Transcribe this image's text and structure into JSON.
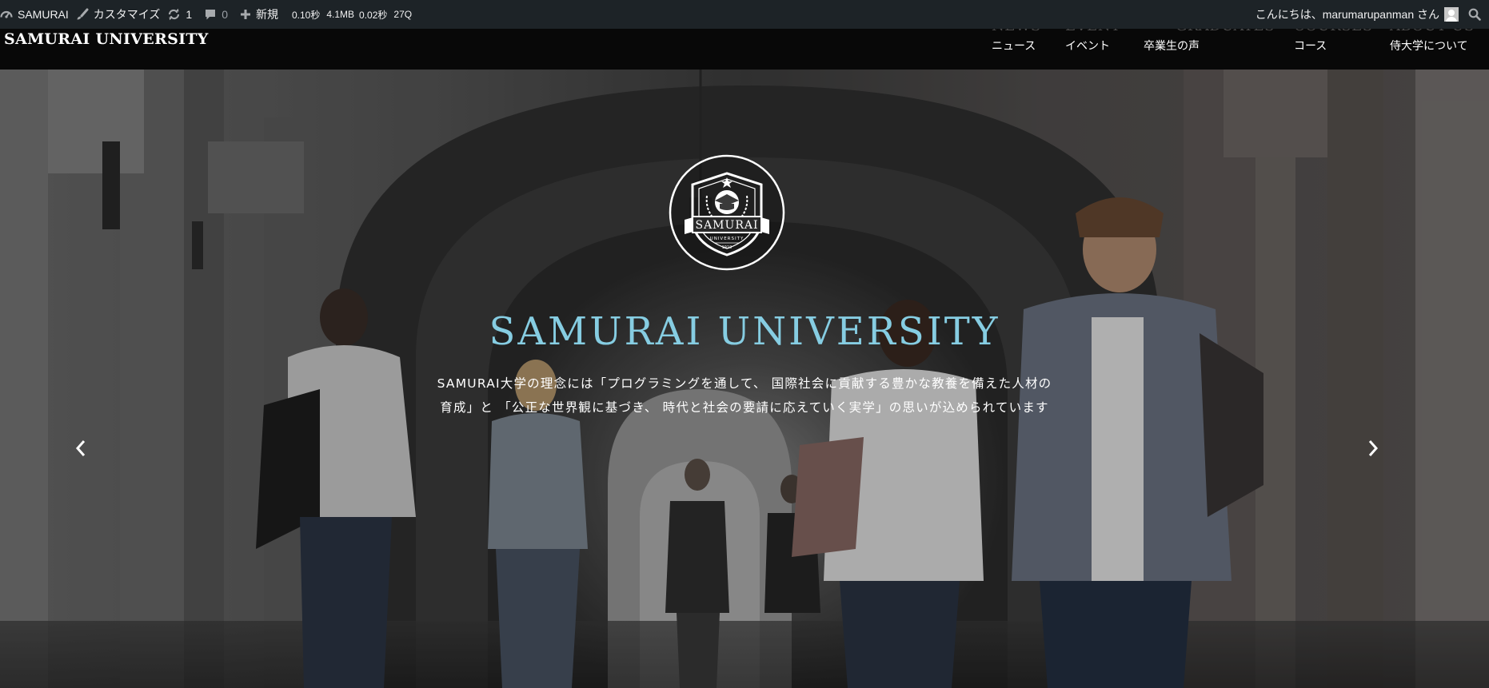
{
  "admin_bar": {
    "site_name": "SAMURAI",
    "customize": "カスタマイズ",
    "updates_count": "1",
    "comments_count": "0",
    "new": "新規",
    "stats": [
      "0.10秒",
      "4.1MB",
      "0.02秒",
      "27Q"
    ],
    "greeting": "こんにちは、marumarupanman さん",
    "icons": [
      "dashboard-icon",
      "brush-icon",
      "refresh-icon",
      "comment-icon",
      "plus-icon",
      "avatar-icon",
      "search-icon"
    ]
  },
  "site_header": {
    "title": "SAMURAI UNIVERSITY",
    "nav": [
      {
        "en": "NEWS",
        "jp": "ニュース"
      },
      {
        "en": "EVENT",
        "jp": "イベント"
      },
      {
        "en": "GRADUATES",
        "jp": "卒業生の声"
      },
      {
        "en": "COURSES",
        "jp": "コース"
      },
      {
        "en": "ABOUT US",
        "jp": "侍大学について"
      }
    ]
  },
  "hero": {
    "title": "SAMURAI UNIVERSITY",
    "text_line1": "SAMURAI大学の理念には「プログラミングを通して、 国際社会に貢献する豊かな教養を備えた人材の",
    "text_line2": "育成」と 「公正な世界観に基づき、 時代と社会の要請に応えていく実学」の思いが込められています",
    "emblem": {
      "name": "SAMURAI",
      "sub": "UNIVERSITY",
      "year": "1919"
    },
    "prev_icon": "chevron-left-icon",
    "next_icon": "chevron-right-icon"
  },
  "colors": {
    "admin_bar": "#1d2327",
    "header": "#0a0a0a",
    "hero_title": "#86cde2"
  }
}
